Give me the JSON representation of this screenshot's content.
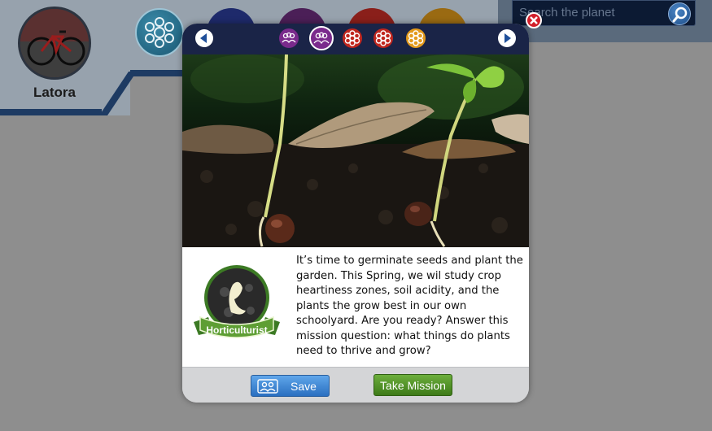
{
  "header": {
    "username": "Latora",
    "search": {
      "placeholder": "Search the planet"
    }
  },
  "modal": {
    "nav_icons": [
      "group-icon",
      "group-icon",
      "flower-icon",
      "flower-icon",
      "flower-icon"
    ],
    "description": "It’s time to germinate seeds and plant the garden. This Spring, we wil study crop heartiness zones, soil acidity, and the plants the grow best in our own schoolyard. Are you ready? Answer this mission question: what things do plants need to thrive and grow?",
    "badge_label": "Horticulturist",
    "buttons": {
      "save_label": "Save",
      "mission_label": "Take Mission"
    }
  },
  "colors": {
    "nav_bar": "#1a2447",
    "save_button": "#3a86d6",
    "mission_button": "#4e8f24",
    "close_button": "#d21f2a"
  }
}
